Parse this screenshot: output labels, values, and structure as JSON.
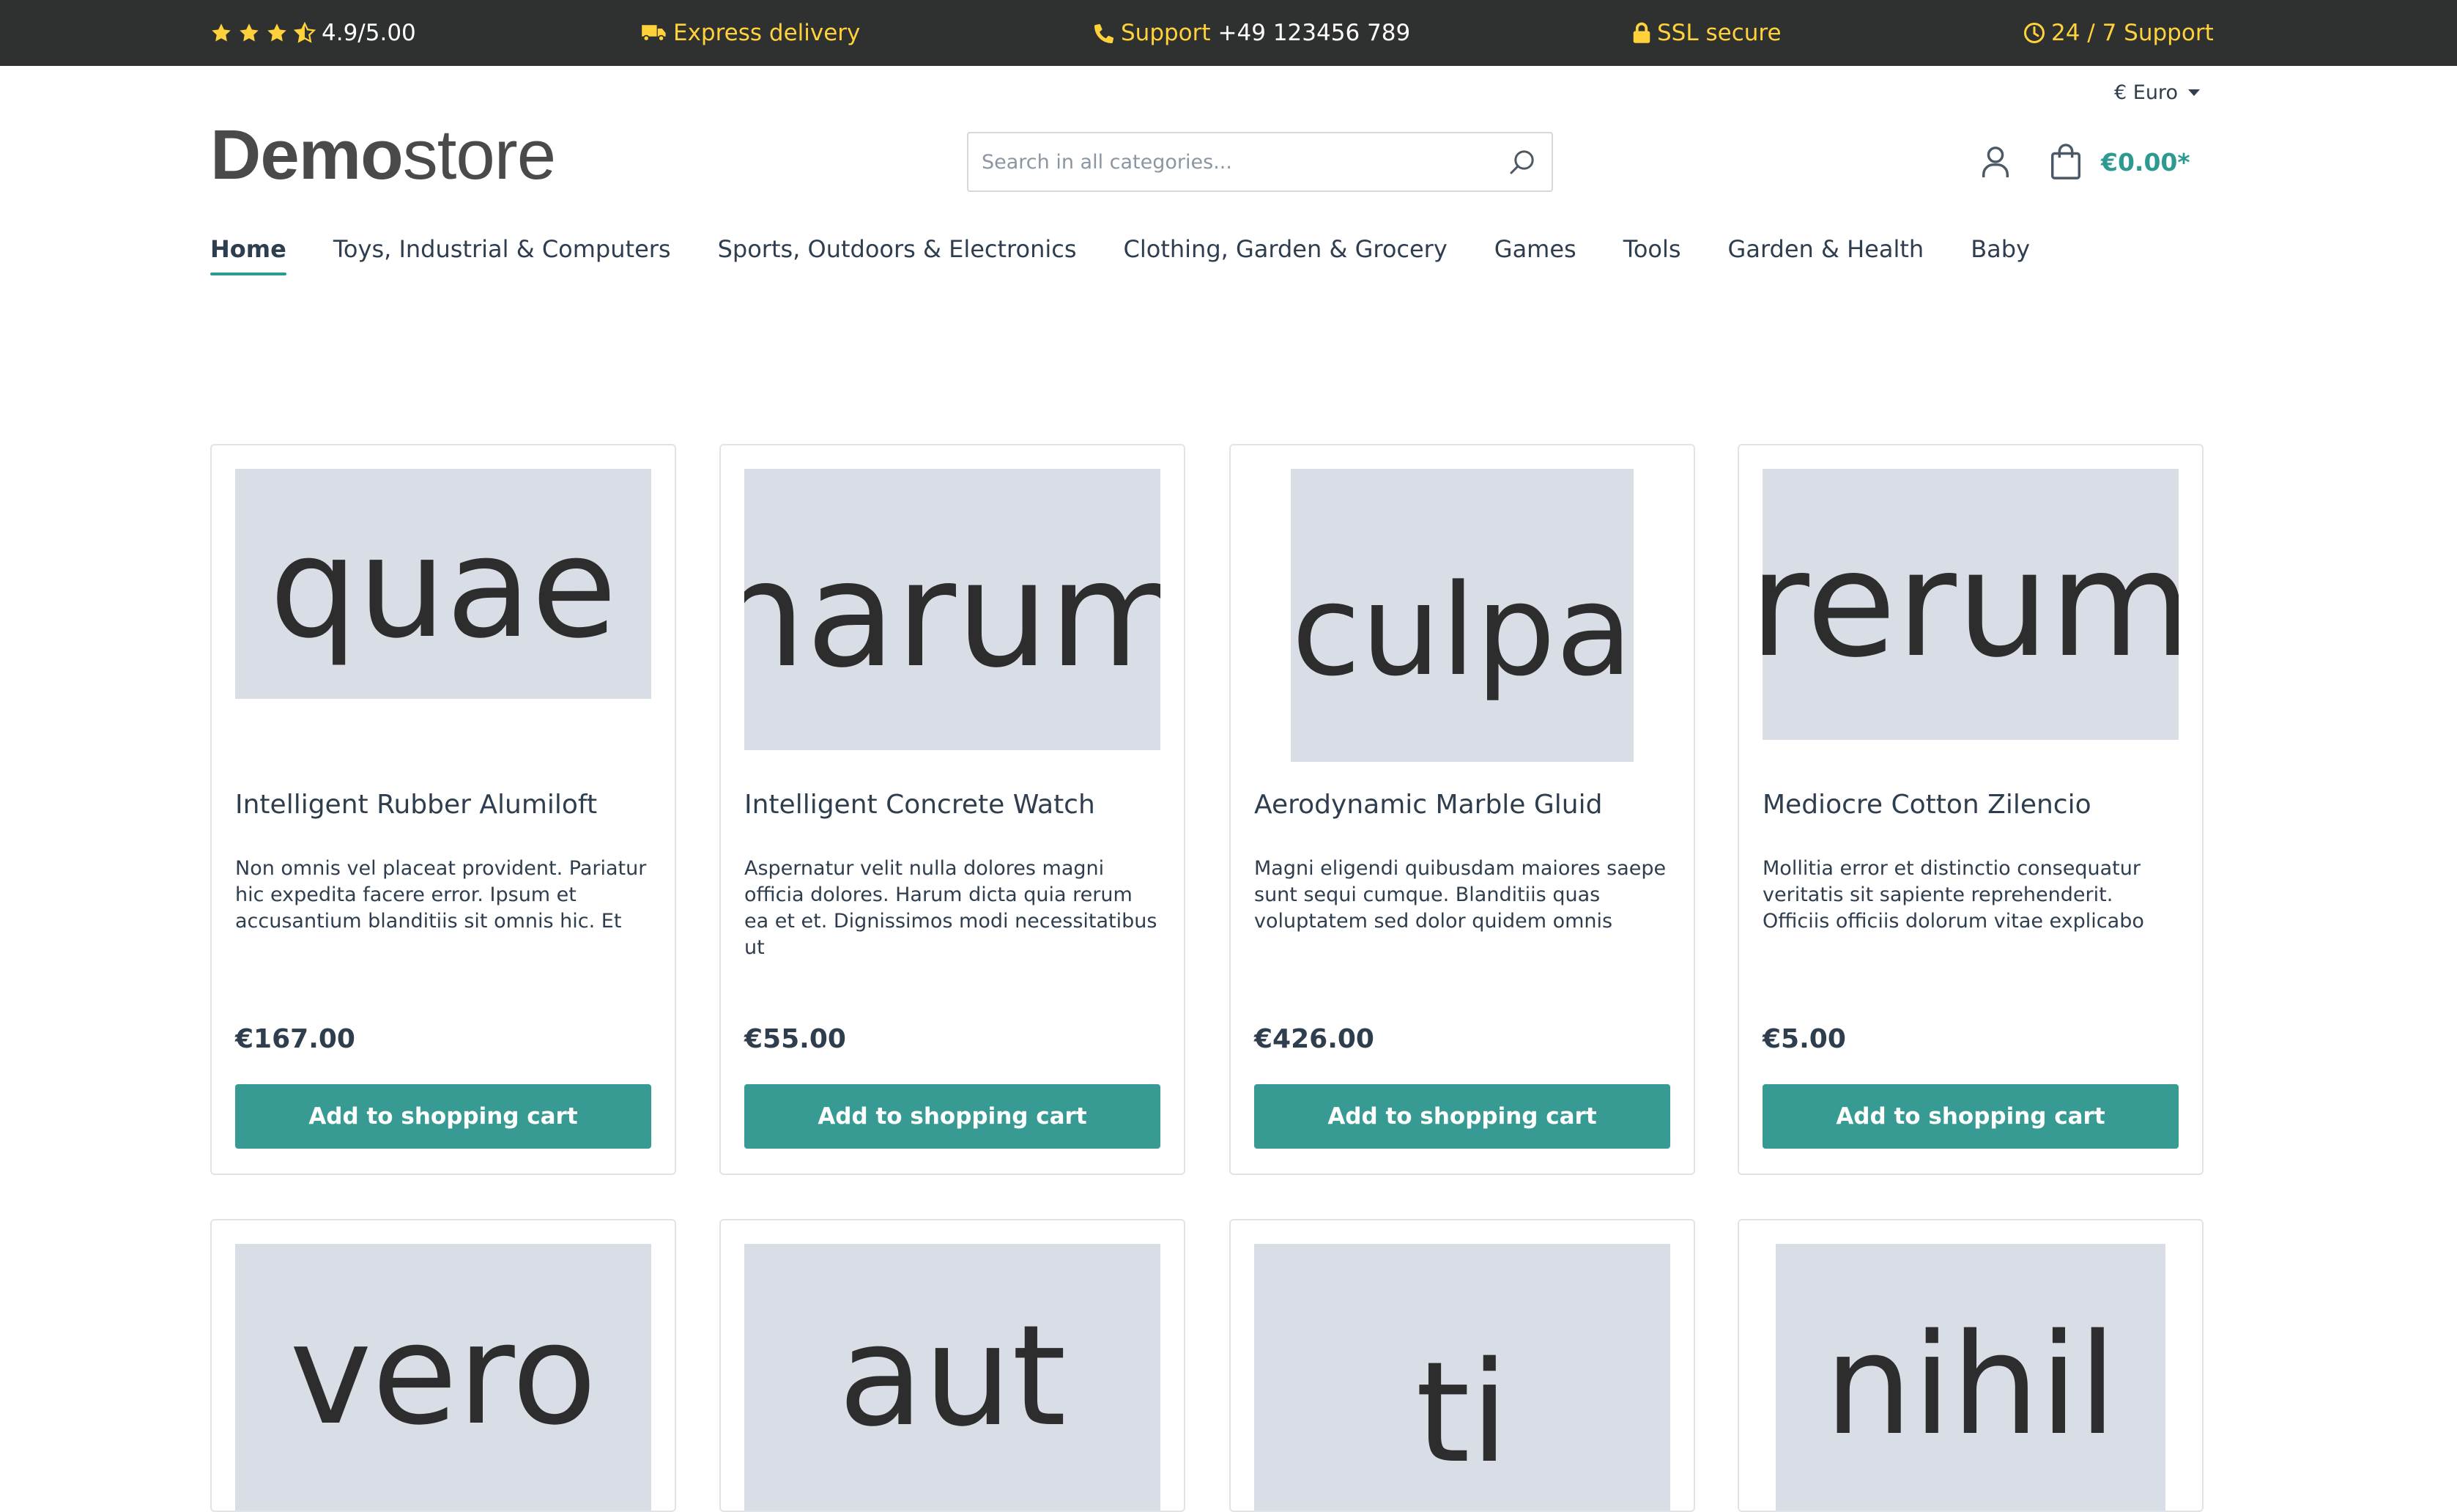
{
  "topbar": {
    "rating": "4.9/5.00",
    "stars_full": 3,
    "stars_half": 1,
    "express": "Express delivery",
    "support_label": "Support",
    "support_phone": "+49 123456 789",
    "ssl": "SSL secure",
    "hours": "24 / 7 Support",
    "accent_color": "#ffd13a"
  },
  "header": {
    "currency": "€ Euro",
    "logo_bold": "Demo",
    "logo_light": "store",
    "search_placeholder": "Search in all categories...",
    "cart_total": "€0.00*"
  },
  "nav": {
    "items": [
      {
        "label": "Home",
        "active": true
      },
      {
        "label": "Toys, Industrial & Computers"
      },
      {
        "label": "Sports, Outdoors & Electronics"
      },
      {
        "label": "Clothing, Garden & Grocery"
      },
      {
        "label": "Games"
      },
      {
        "label": "Tools"
      },
      {
        "label": "Garden & Health"
      },
      {
        "label": "Baby"
      }
    ]
  },
  "products": [
    {
      "image_text": "quae",
      "name": "Intelligent Rubber Alumiloft",
      "description": "Non omnis vel placeat provident. Pariatur hic expedita facere error. Ipsum et accusantium blanditiis sit omnis hic. Et",
      "price": "€167.00",
      "button": "Add to shopping cart"
    },
    {
      "image_text": "harum",
      "name": "Intelligent Concrete Watch",
      "description": "Aspernatur velit nulla dolores magni officia dolores. Harum dicta quia rerum ea et et. Dignissimos modi necessitatibus ut",
      "price": "€55.00",
      "button": "Add to shopping cart"
    },
    {
      "image_text": "culpa",
      "name": "Aerodynamic Marble Gluid",
      "description": "Magni eligendi quibusdam maiores saepe sunt sequi cumque. Blanditiis quas voluptatem sed dolor quidem omnis",
      "price": "€426.00",
      "button": "Add to shopping cart"
    },
    {
      "image_text": "rerum",
      "name": "Mediocre Cotton Zilencio",
      "description": "Mollitia error et distinctio consequatur veritatis sit sapiente reprehenderit. Officiis officiis dolorum vitae explicabo",
      "price": "€5.00",
      "button": "Add to shopping cart"
    }
  ],
  "products_row2": [
    {
      "image_text": "vero"
    },
    {
      "image_text": "aut"
    },
    {
      "image_text": "ti"
    },
    {
      "image_text": "nihil"
    }
  ],
  "colors": {
    "brand": "#379b94",
    "topbar_bg": "#2f3130",
    "placeholder_bg": "#d9dde5"
  }
}
